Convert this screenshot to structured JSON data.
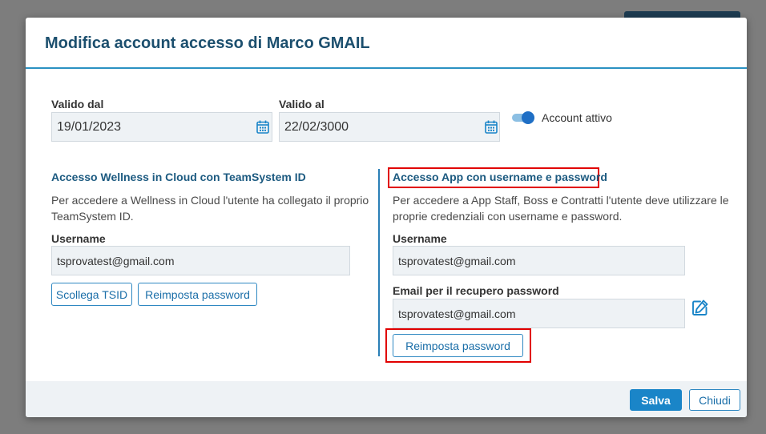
{
  "modal": {
    "title": "Modifica account accesso di Marco GMAIL"
  },
  "validity": {
    "from_label": "Valido dal",
    "from_value": "19/01/2023",
    "to_label": "Valido al",
    "to_value": "22/02/3000",
    "active_label": "Account attivo",
    "active": true
  },
  "wellness": {
    "title": "Accesso Wellness in Cloud con TeamSystem ID",
    "description": "Per accedere a Wellness in Cloud l'utente ha collegato il proprio TeamSystem ID.",
    "username_label": "Username",
    "username_value": "tsprovatest@gmail.com",
    "unlink_button": "Scollega TSID",
    "reset_button": "Reimposta password"
  },
  "app_access": {
    "title": "Accesso App con username e password",
    "description": "Per accedere a App Staff, Boss e Contratti l'utente deve utilizzare le proprie credenziali con username e password.",
    "username_label": "Username",
    "username_value": "tsprovatest@gmail.com",
    "email_label": "Email per il recupero password",
    "email_value": "tsprovatest@gmail.com",
    "reset_button": "Reimposta password"
  },
  "footer": {
    "save_button": "Salva",
    "close_button": "Chiudi"
  },
  "icons": {
    "calendar": "calendar-icon",
    "edit": "edit-icon"
  },
  "colors": {
    "primary": "#1a85c8",
    "title": "#1c4f6e",
    "highlight": "#e10000",
    "field_bg": "#eef2f5"
  }
}
